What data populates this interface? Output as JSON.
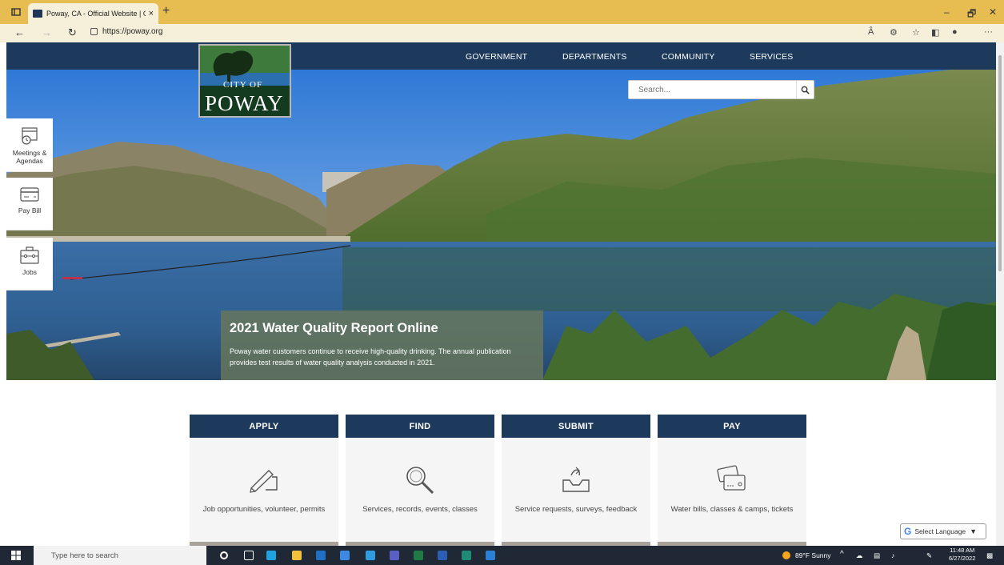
{
  "browser": {
    "tab_title": "Poway, CA - Official Website | Of",
    "tab_close": "×",
    "new_tab": "+",
    "url": "https://poway.org",
    "read_aloud": "Â",
    "more": "···"
  },
  "nav": {
    "items": [
      {
        "label": "GOVERNMENT"
      },
      {
        "label": "DEPARTMENTS"
      },
      {
        "label": "COMMUNITY"
      },
      {
        "label": "SERVICES"
      }
    ]
  },
  "logo": {
    "city_of": "CITY OF",
    "name": "POWAY"
  },
  "search": {
    "placeholder": "Search..."
  },
  "quick_links": [
    {
      "label": "Meetings & Agendas",
      "icon": "calendar-clock-icon"
    },
    {
      "label": "Pay Bill",
      "icon": "credit-card-icon"
    },
    {
      "label": "Jobs",
      "icon": "briefcase-icon"
    }
  ],
  "hero": {
    "title": "2021 Water Quality Report Online",
    "body": "Poway water customers continue to receive high-quality drinking. The annual publication provides test results of water quality analysis conducted in 2021."
  },
  "cards": [
    {
      "title": "APPLY",
      "desc": "Job opportunities, volunteer, permits",
      "icon": "signing-hand-icon"
    },
    {
      "title": "FIND",
      "desc": "Services, records, events, classes",
      "icon": "magnifier-icon"
    },
    {
      "title": "SUBMIT",
      "desc": "Service requests, surveys, feedback",
      "icon": "inbox-upload-icon"
    },
    {
      "title": "PAY",
      "desc": "Water bills, classes & camps, tickets",
      "icon": "card-payment-icon"
    }
  ],
  "translate": {
    "label": "Select Language"
  },
  "taskbar": {
    "search_placeholder": "Type here to search",
    "weather": "89°F Sunny",
    "time": "11:48 AM",
    "date": "6/27/2022"
  },
  "colors": {
    "nav": "#1d3a5c",
    "tabbar": "#e7bd52",
    "card_bg": "#f5f5f6"
  }
}
